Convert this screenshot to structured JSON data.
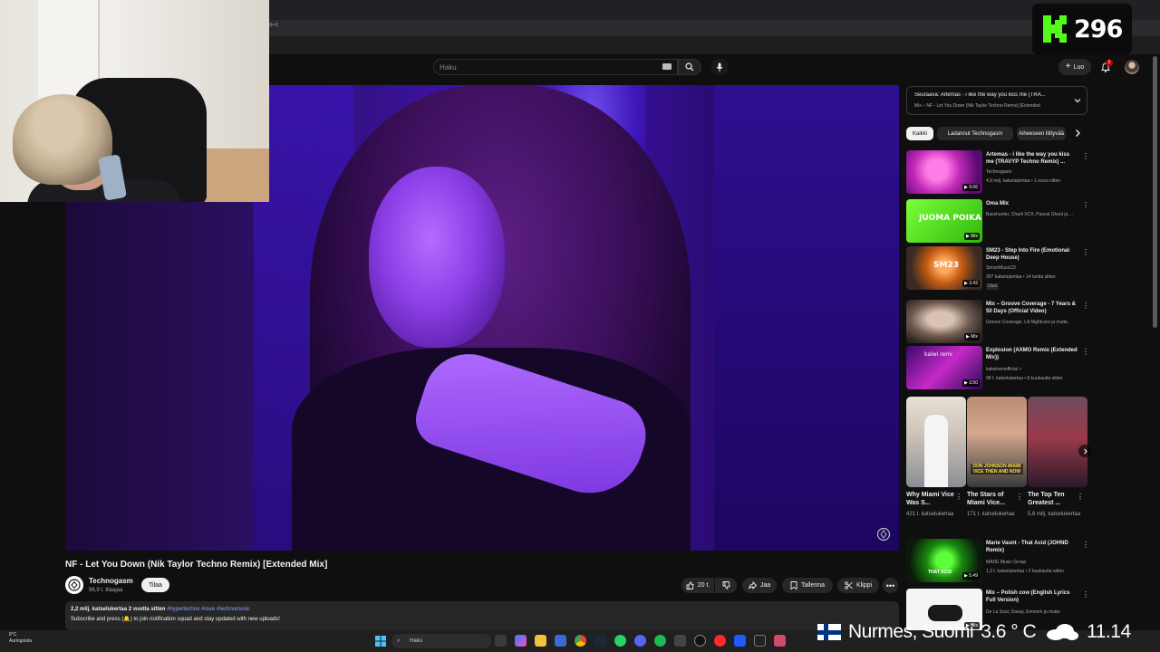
{
  "browser": {
    "url_fragment": "o=1"
  },
  "kick": {
    "logo_letter": "K",
    "count": "296",
    "accent": "#53fc18"
  },
  "header": {
    "search_placeholder": "Haku",
    "create_label": "Luo",
    "notifications_count": "2"
  },
  "video": {
    "title": "NF - Let You Down (Nik Taylor Techno Remix) [Extended Mix]",
    "channel": "Technogasm",
    "subscribers": "96,9 t. tilaajaa",
    "subscribe_label": "Tilaa",
    "likes": "20 t.",
    "share_label": "Jaa",
    "save_label": "Tallenna",
    "clip_label": "Klippi",
    "views_and_date": "2,2 milj. katselukertaa  2 vuotta sitten",
    "hashtags": "#hypertechno #rave #technomusic",
    "description": "Subscribe and press (🔔) to join notification squad and stay updated with new uploads!"
  },
  "queue": {
    "next_label": "Seuraava: Artemas - i like the way you kiss me (TRA...",
    "mix_label": "Mix – NF - Let You Down (Nik Taylor Techno Remix) [Extended"
  },
  "chips": [
    "Kaikki",
    "Ladannut Technogasm",
    "Aiheeseen liittyvää"
  ],
  "recommendations": [
    {
      "title": "Artemas - i like the way you kiss me (TRAVYP Techno Remix) ...",
      "line1": "Technogasm",
      "line2": "4,9 milj. katselukertaa • 1 vuosi sitten",
      "duration": "9.06",
      "badge": ""
    },
    {
      "title": "Oma Mix",
      "line1": "Basshunter, Charli XCX, Pascal Ghost ja ...",
      "line2": "",
      "duration": "Mix",
      "badge": "",
      "thumb_text": "JUOMA POIKA"
    },
    {
      "title": "SM23 - Step Into Fire (Emotional Deep House)",
      "line1": "SimonMusic23",
      "line2": "307 katselukertaa • 14 tuntia sitten",
      "duration": "3.42",
      "badge": "Uusi",
      "thumb_text": "SM23"
    },
    {
      "title": "Mix – Groove Coverage - 7 Years & 50 Days (Official Video)",
      "line1": "Groove Coverage, LA Nightcore ja muita",
      "line2": "",
      "duration": "Mix",
      "badge": ""
    },
    {
      "title": "Explosion (AXMO Remix (Extended Mix))",
      "line1": "kalwiremiofficial ✓",
      "line2": "98 t. katselukertaa • 6 kuukautta sitten",
      "duration": "3.50",
      "badge": "",
      "thumb_text": "kalwi remi"
    },
    {
      "title": "Marie Vaunt - That Acid (JOHND Remix)",
      "line1": "MADE Music Group",
      "line2": "1,3 t. katselukertaa • 2 kuukautta sitten",
      "duration": "5.49",
      "badge": "",
      "thumb_text": "THAT ACID"
    },
    {
      "title": "Mix – Polish cow (English Lyrics Full Version)",
      "line1": "De La Soul, Davay, Eminem ja muita",
      "line2": "",
      "duration": "Mix",
      "badge": ""
    }
  ],
  "shorts": [
    {
      "title": "Why Miami Vice Was S...",
      "views": "421 t. katselukertaa"
    },
    {
      "title": "The Stars of Miami Vice...",
      "views": "171 t. katselukertaa",
      "thumb_text": "DON JOHNSON MIAMI VICE THEN AND NOW"
    },
    {
      "title": "The Top Ten Greatest ...",
      "views": "5,8 milj. katselukertaa"
    }
  ],
  "taskbar": {
    "weather_temp": "8°C",
    "weather_desc": "Auringoista",
    "search_label": "Haku"
  },
  "overlay": {
    "location": "Nurmes, Suomi",
    "temperature": "3.6 ° C",
    "time": "11.14"
  },
  "colors": {
    "bg": "#0f0f0f",
    "chip_bg": "#272727",
    "text": "#f1f1f1",
    "muted": "#aaaaaa",
    "youtube_red": "#ff0000"
  }
}
